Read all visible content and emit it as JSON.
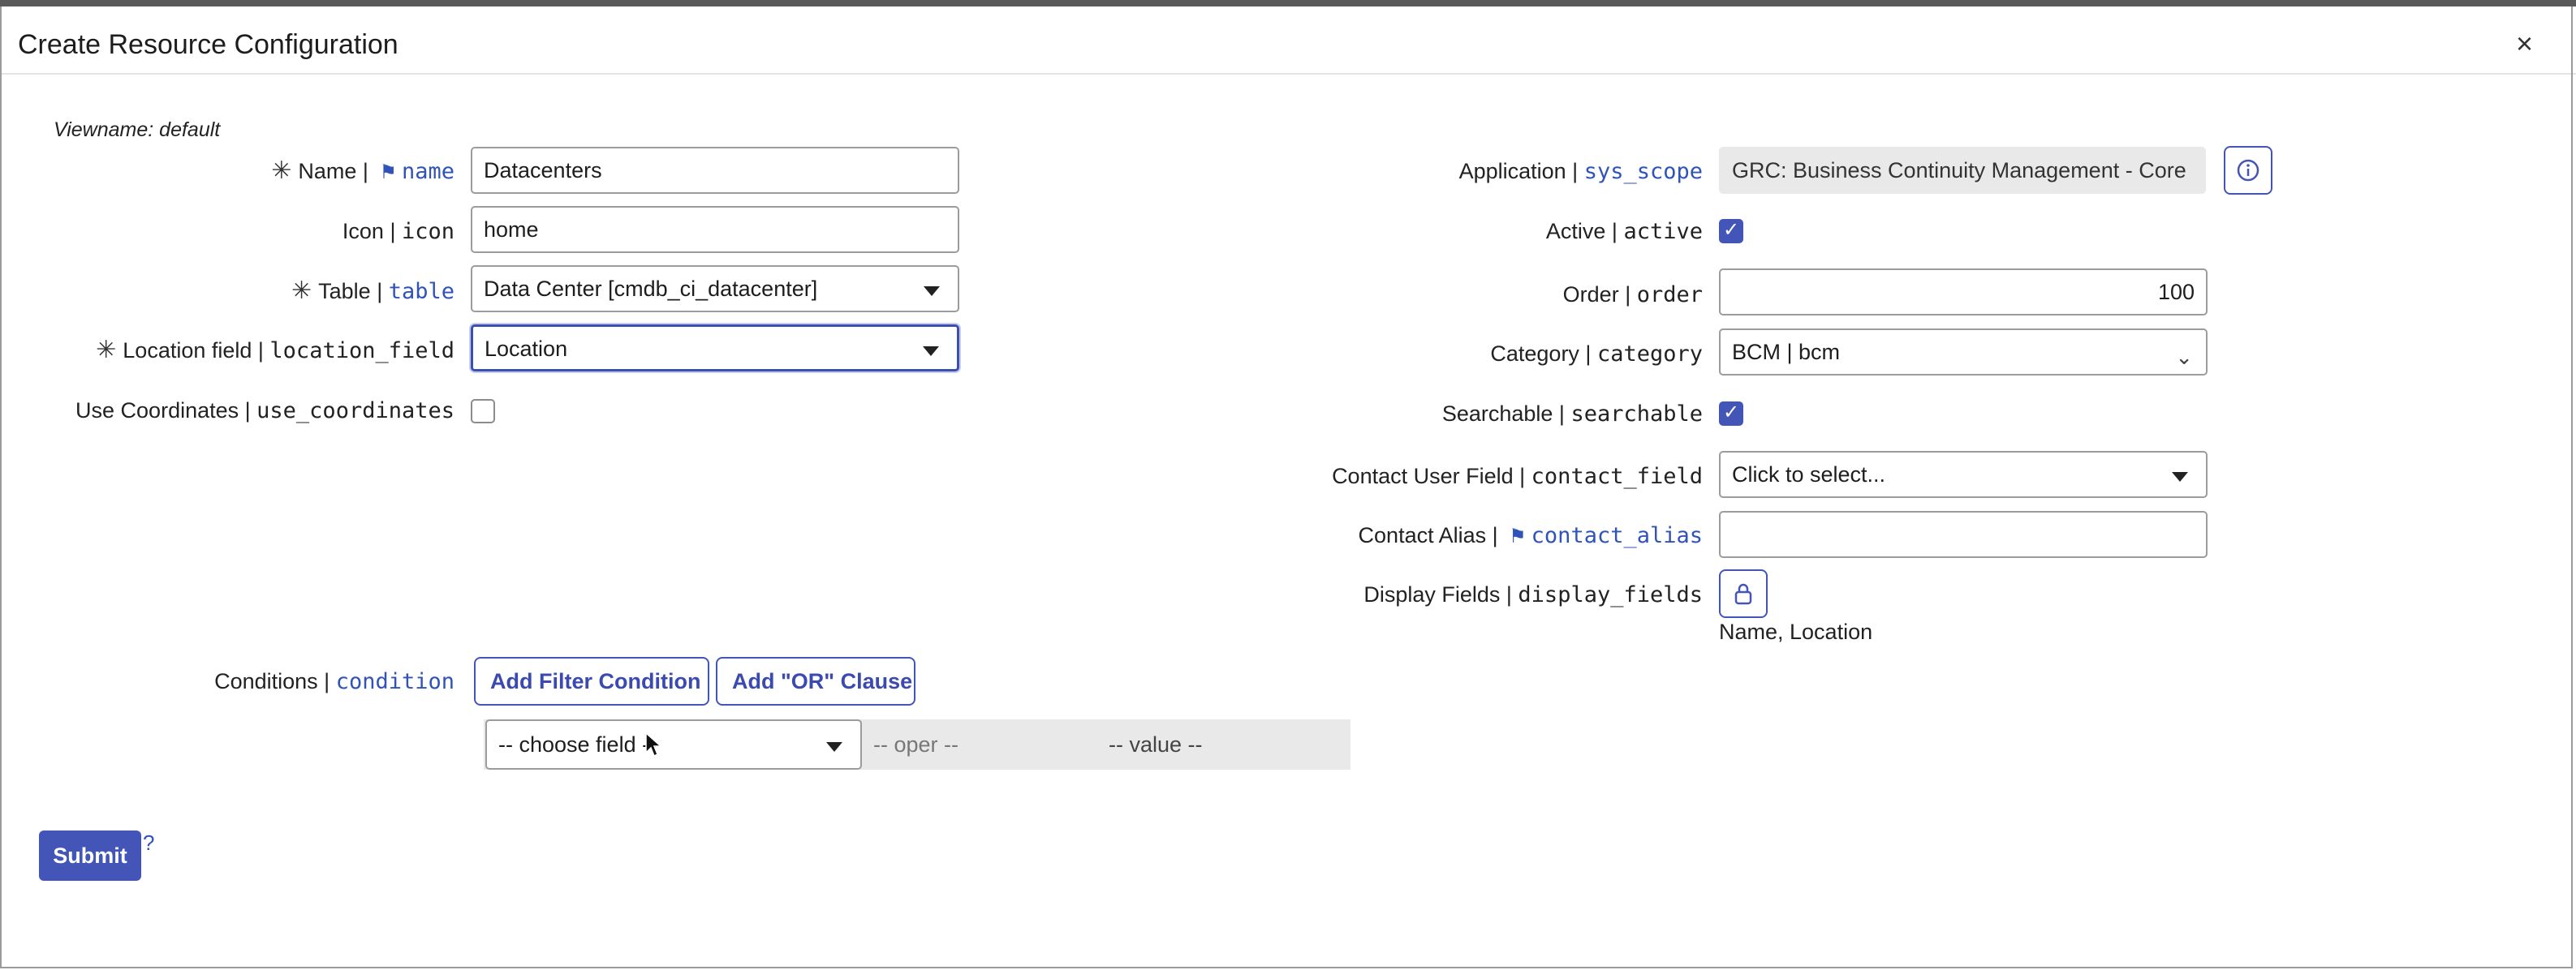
{
  "dialog": {
    "title": "Create Resource Configuration",
    "close_glyph": "×",
    "viewname": "Viewname: default"
  },
  "left": {
    "name": {
      "label": "Name | ",
      "field": "name",
      "value": "Datacenters"
    },
    "icon": {
      "label": "Icon | ",
      "field": "icon",
      "value": "home"
    },
    "table": {
      "label": "Table | ",
      "field": "table",
      "value": "Data Center [cmdb_ci_datacenter]"
    },
    "location_field": {
      "label": "Location field | ",
      "field": "location_field",
      "value": "Location"
    },
    "use_coordinates": {
      "label": "Use Coordinates | ",
      "field": "use_coordinates",
      "checked": false
    },
    "conditions": {
      "label": "Conditions | ",
      "field": "condition",
      "add_filter": "Add Filter Condition",
      "add_or": "Add \"OR\" Clause",
      "choose_field": "-- choose field --",
      "oper": "-- oper --",
      "value": "-- value --"
    }
  },
  "right": {
    "application": {
      "label": "Application | ",
      "field": "sys_scope",
      "value": "GRC: Business Continuity Management - Core"
    },
    "active": {
      "label": "Active | ",
      "field": "active",
      "checked": true
    },
    "order": {
      "label": "Order | ",
      "field": "order",
      "value": "100"
    },
    "category": {
      "label": "Category | ",
      "field": "category",
      "value": "BCM | bcm"
    },
    "searchable": {
      "label": "Searchable | ",
      "field": "searchable",
      "checked": true
    },
    "contact_field": {
      "label": "Contact User Field | ",
      "field": "contact_field",
      "value": "Click to select..."
    },
    "contact_alias": {
      "label": "Contact Alias | ",
      "field": "contact_alias",
      "value": ""
    },
    "display_fields": {
      "label": "Display Fields | ",
      "field": "display_fields",
      "value": "Name, Location"
    }
  },
  "footer": {
    "submit": "Submit",
    "help": "?"
  },
  "icons": {
    "required": "required-asterisk-icon",
    "flag": "flag-icon",
    "info": "info-icon",
    "lock": "lock-icon"
  }
}
